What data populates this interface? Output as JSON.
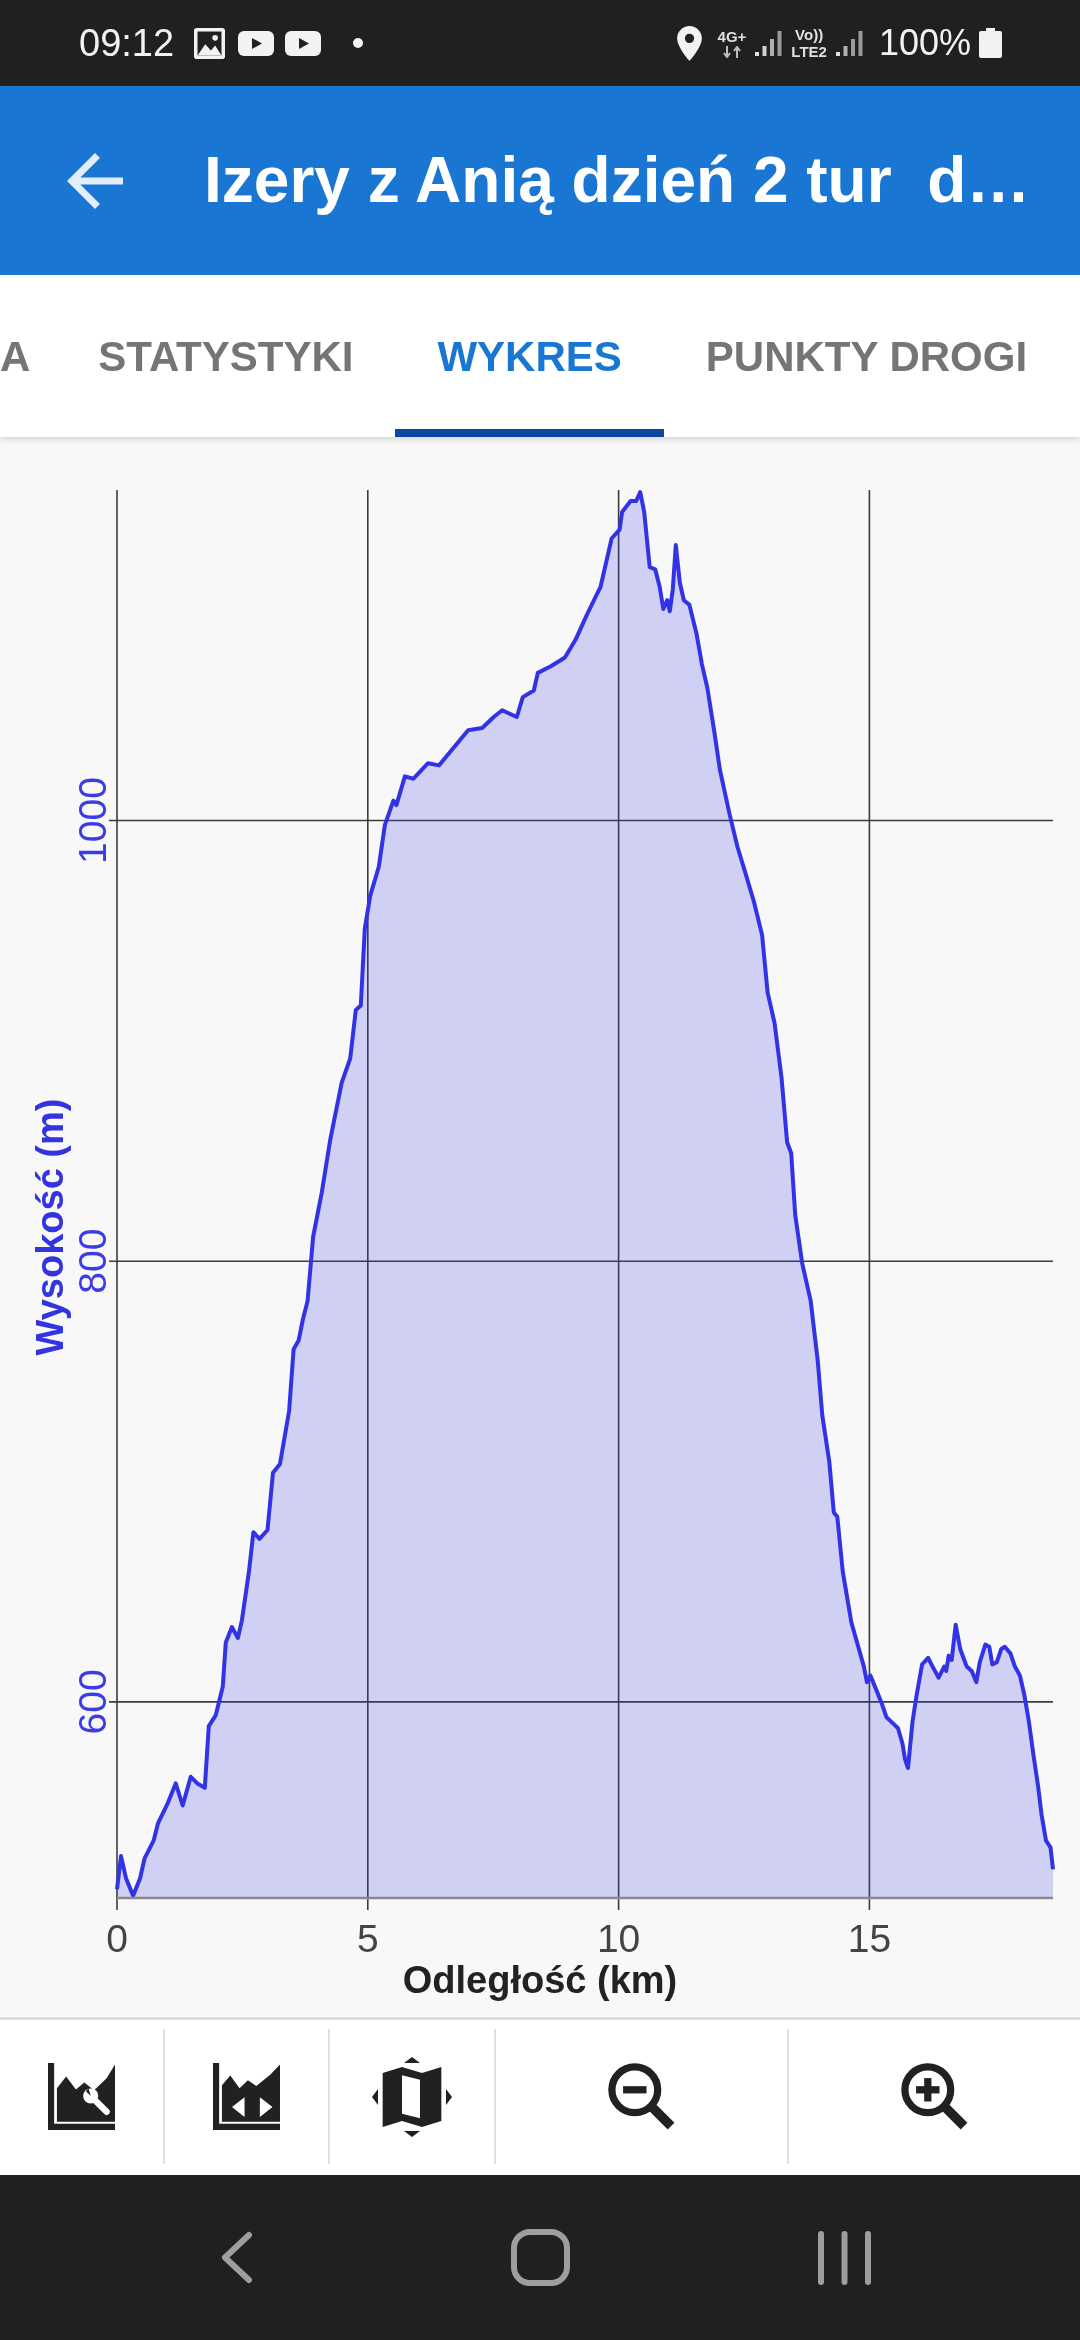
{
  "status_bar": {
    "time": "09:12",
    "network_type": "4G+",
    "call_label": "Vo))",
    "call_network": "LTE2",
    "battery": "100%"
  },
  "app_bar": {
    "title": "Izery z Anią dzień 2 tur  d…"
  },
  "tabs": [
    {
      "label": "A",
      "selected": false
    },
    {
      "label": "STATYSTYKI",
      "selected": false
    },
    {
      "label": "WYKRES",
      "selected": true
    },
    {
      "label": "PUNKTY DROGI",
      "selected": false
    }
  ],
  "chart": {
    "chart_data": {
      "type": "area",
      "xlabel": "Odległość (km)",
      "ylabel": "Wysokość (m)",
      "grid": true,
      "xlim": [
        0,
        18.66
      ],
      "ylim": [
        511,
        1150
      ],
      "xticks": [
        0,
        5,
        10,
        15
      ],
      "yticks": [
        600,
        800,
        1000
      ],
      "x": [
        0,
        0.08,
        0.18,
        0.32,
        0.46,
        0.55,
        0.73,
        0.82,
        1.01,
        1.17,
        1.31,
        1.47,
        1.6,
        1.75,
        1.83,
        1.97,
        2.11,
        2.17,
        2.29,
        2.41,
        2.49,
        2.63,
        2.72,
        2.84,
        3,
        3.11,
        3.25,
        3.43,
        3.52,
        3.62,
        3.71,
        3.8,
        3.91,
        4.08,
        4.25,
        4.48,
        4.65,
        4.76,
        4.86,
        4.94,
        5.05,
        5.22,
        5.34,
        5.51,
        5.57,
        5.74,
        5.91,
        6.2,
        6.42,
        6.71,
        7,
        7.28,
        7.51,
        7.68,
        7.97,
        8.09,
        8.31,
        8.39,
        8.65,
        8.93,
        9.14,
        9.36,
        9.53,
        9.64,
        9.8,
        9.86,
        10.02,
        10.07,
        10.24,
        10.35,
        10.43,
        10.51,
        10.62,
        10.73,
        10.82,
        10.89,
        10.97,
        11.02,
        11.08,
        11.14,
        11.22,
        11.3,
        11.41,
        11.55,
        11.66,
        11.77,
        11.91,
        12.02,
        12.21,
        12.37,
        12.53,
        12.7,
        12.86,
        12.97,
        13.11,
        13.25,
        13.36,
        13.44,
        13.52,
        13.66,
        13.83,
        13.97,
        14.06,
        14.2,
        14.29,
        14.36,
        14.47,
        14.56,
        14.64,
        14.79,
        14.89,
        14.95,
        15.02,
        15.11,
        15.25,
        15.34,
        15.48,
        15.57,
        15.66,
        15.71,
        15.77,
        15.86,
        15.94,
        16.05,
        16.17,
        16.26,
        16.38,
        16.49,
        16.53,
        16.58,
        16.64,
        16.72,
        16.81,
        16.94,
        17.04,
        17.13,
        17.2,
        17.31,
        17.39,
        17.45,
        17.54,
        17.63,
        17.7,
        17.81,
        17.9,
        18,
        18.09,
        18.18,
        18.27,
        18.36,
        18.43,
        18.52,
        18.61,
        18.66
      ],
      "series": [
        {
          "color": "#3333e6",
          "values": [
            515,
            530,
            520,
            512,
            520,
            529,
            537,
            545,
            554,
            563,
            553,
            566,
            563,
            561,
            589,
            594,
            607,
            627,
            634,
            629,
            637,
            659,
            677,
            674,
            678,
            704,
            708,
            732,
            760,
            764,
            774,
            782,
            811,
            831,
            855,
            881,
            892,
            914,
            916,
            951,
            966,
            979,
            998,
            1009,
            1007,
            1020,
            1019,
            1026,
            1025,
            1033,
            1041,
            1042,
            1047,
            1050,
            1047,
            1056,
            1059,
            1067,
            1070,
            1074,
            1082,
            1093,
            1101,
            1106,
            1122,
            1128,
            1132,
            1140,
            1145,
            1145,
            1149,
            1140,
            1115,
            1114,
            1106,
            1096,
            1100,
            1095,
            1105,
            1125,
            1108,
            1100,
            1098,
            1085,
            1071,
            1060,
            1040,
            1023,
            1003,
            988,
            976,
            963,
            948,
            922,
            908,
            883,
            854,
            849,
            821,
            799,
            782,
            755,
            730,
            709,
            686,
            684,
            659,
            647,
            636,
            624,
            616,
            609,
            612,
            607,
            599,
            593,
            590,
            588,
            581,
            574,
            570,
            591,
            603,
            617,
            620,
            616,
            611,
            616,
            614,
            621,
            619,
            635,
            624,
            616,
            614,
            609,
            618,
            626,
            625,
            617,
            618,
            624,
            625,
            622,
            616,
            612,
            603,
            591,
            576,
            562,
            549,
            537,
            534,
            524
          ]
        }
      ]
    }
  }
}
